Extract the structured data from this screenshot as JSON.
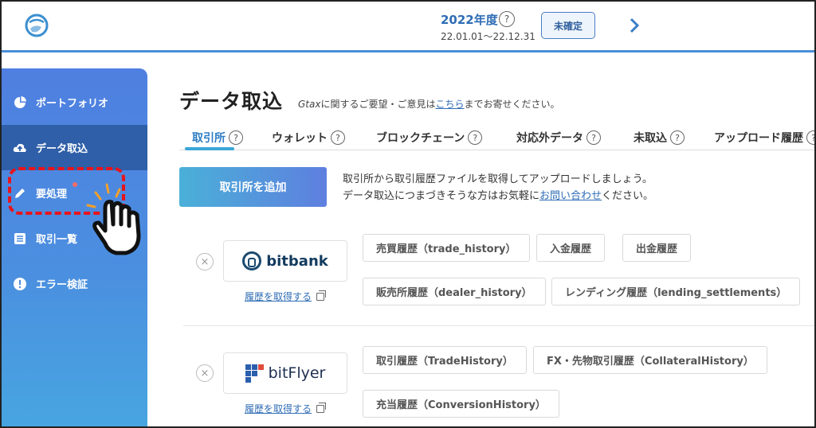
{
  "header": {
    "year_title": "2022年度",
    "year_help": "?",
    "year_range": "22.01.01〜22.12.31",
    "status_label": "未確定",
    "accent_color": "#4a90d9"
  },
  "sidebar": {
    "items": [
      {
        "label": "ポートフォリオ",
        "icon": "pie-chart-icon"
      },
      {
        "label": "データ取込",
        "icon": "cloud-upload-icon",
        "active": true
      },
      {
        "label": "要処理",
        "icon": "pencil-icon",
        "badge": true
      },
      {
        "label": "取引一覧",
        "icon": "list-icon"
      },
      {
        "label": "エラー検証",
        "icon": "alert-icon"
      }
    ]
  },
  "main": {
    "title": "データ取込",
    "feedback_prefix": "Gtax",
    "feedback_mid": "に関するご要望・ご意見は",
    "feedback_link": "こちら",
    "feedback_suffix": "までお寄せください。",
    "tabs": [
      {
        "label": "取引所",
        "help": "?",
        "active": true
      },
      {
        "label": "ウォレット",
        "help": "?"
      },
      {
        "label": "ブロックチェーン",
        "help": "?"
      },
      {
        "label": "対応外データ",
        "help": "?"
      },
      {
        "label": "未取込",
        "help": "?"
      },
      {
        "label": "アップロード履歴",
        "help": "?"
      }
    ],
    "add_button": "取引所を追加",
    "intro_line1": "取引所から取引履歴ファイルを取得してアップロードしましょう。",
    "intro_line2_prefix": "データ取込につまづきそうな方はお気軽に",
    "intro_line2_link": "お問い合わせ",
    "intro_line2_suffix": "ください。"
  },
  "exchanges": [
    {
      "name": "bitbank",
      "remove": "×",
      "fetch_link": "履歴を取得する",
      "chips": [
        "売買履歴（trade_history）",
        "入金履歴",
        "出金履歴",
        "販売所履歴（dealer_history）",
        "レンディング履歴（lending_settlements）"
      ]
    },
    {
      "name": "bitFlyer",
      "remove": "×",
      "fetch_link": "履歴を取得する",
      "chips": [
        "取引履歴（TradeHistory）",
        "FX・先物取引履歴（CollateralHistory）",
        "充当履歴（ConversionHistory）"
      ]
    }
  ]
}
